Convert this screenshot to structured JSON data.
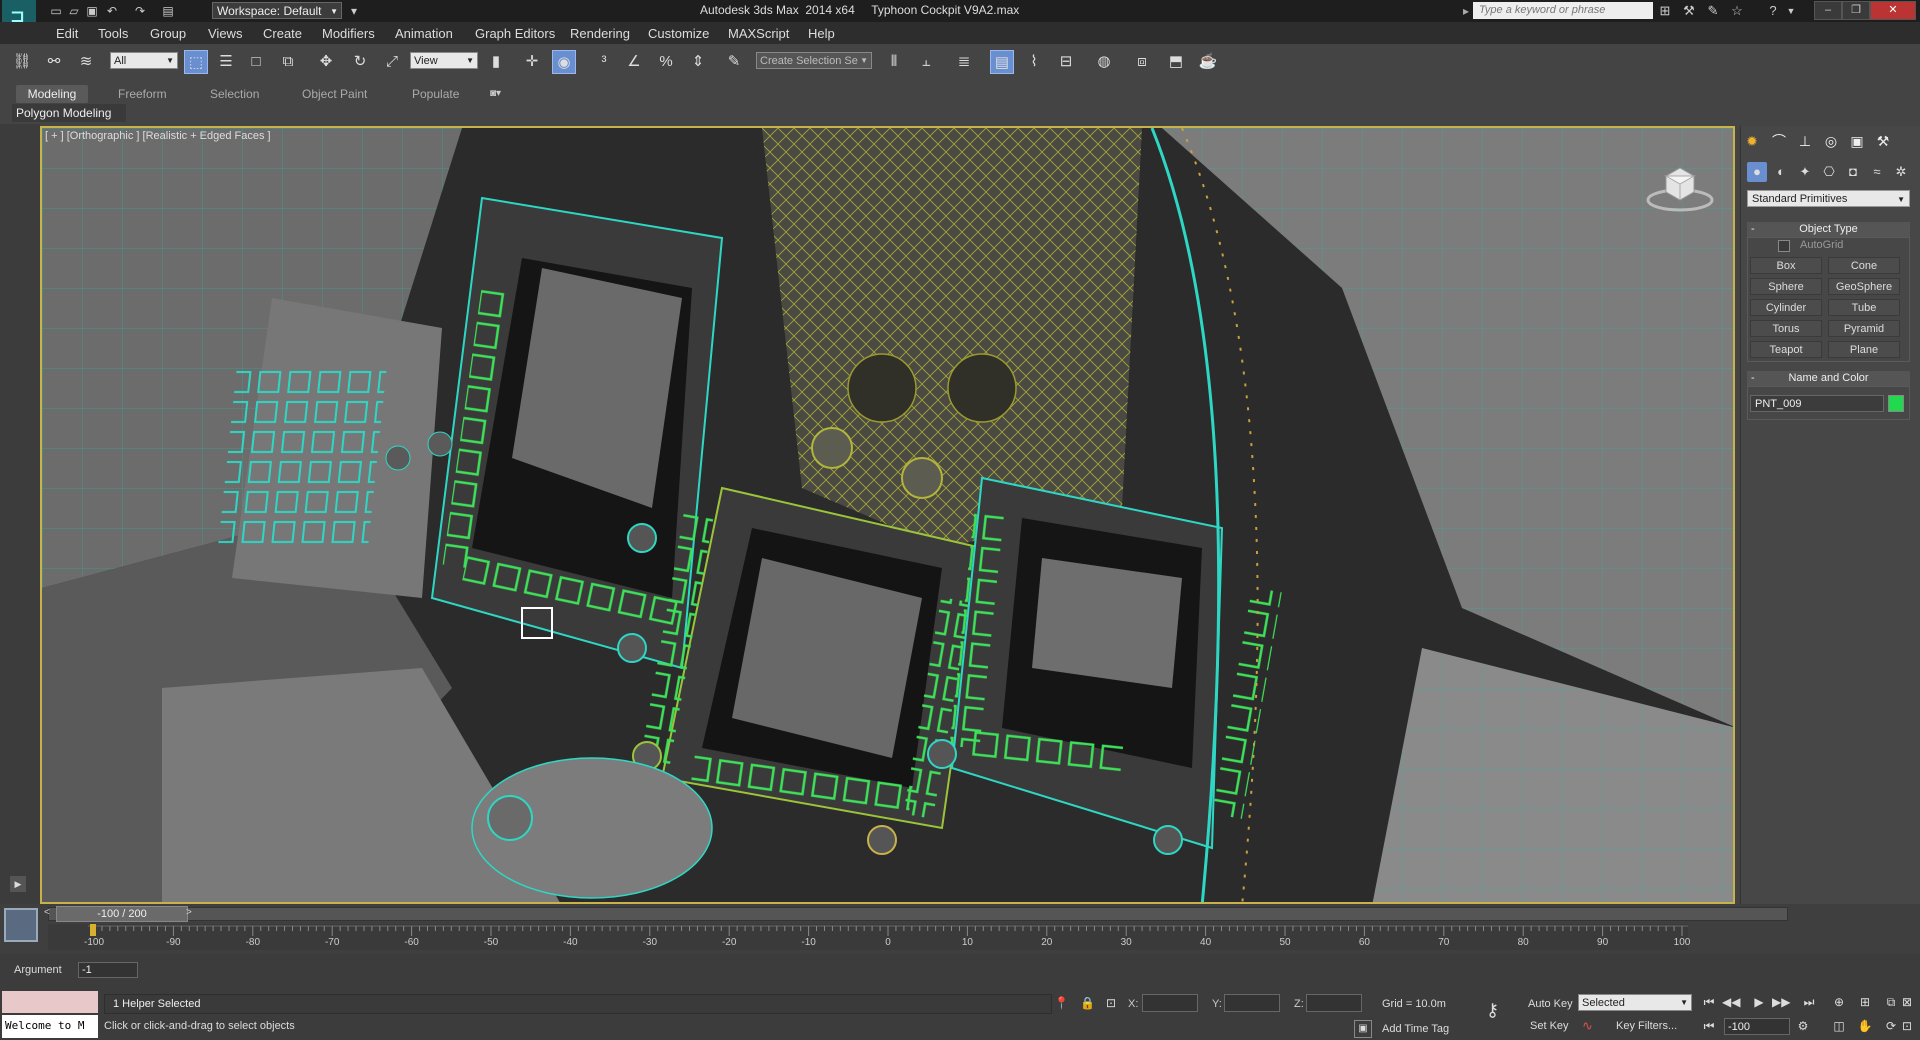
{
  "window": {
    "title": "Autodesk 3ds Max  2014 x64     Typhoon Cockpit V9A2.max",
    "workspace": "Workspace: Default",
    "search_placeholder": "Type a keyword or phrase"
  },
  "menu": [
    "Edit",
    "Tools",
    "Group",
    "Views",
    "Create",
    "Modifiers",
    "Animation",
    "Graph Editors",
    "Rendering",
    "Customize",
    "MAXScript",
    "Help"
  ],
  "toolbar": {
    "selection_filter": "All",
    "reference_coord": "View",
    "named_selection_placeholder": "Create Selection Se"
  },
  "ribbon": {
    "tabs": [
      "Modeling",
      "Freeform",
      "Selection",
      "Object Paint",
      "Populate"
    ],
    "active_tab": "Modeling",
    "panel": "Polygon Modeling"
  },
  "viewport": {
    "label": "[ + ] [Orthographic ] [Realistic + Edged Faces ]"
  },
  "command_panel": {
    "category": "Standard Primitives",
    "object_type_title": "Object Type",
    "autogrid": "AutoGrid",
    "primitives": [
      "Box",
      "Cone",
      "Sphere",
      "GeoSphere",
      "Cylinder",
      "Tube",
      "Torus",
      "Pyramid",
      "Teapot",
      "Plane"
    ],
    "name_color_title": "Name and Color",
    "object_name": "PNT_009",
    "object_color": "#21d94e"
  },
  "timeline": {
    "frame_display": "-100 / 200",
    "ticks": [
      "-100",
      "-90",
      "-80",
      "-70",
      "-60",
      "-50",
      "-40",
      "-30",
      "-20",
      "-10",
      "0",
      "10",
      "20",
      "30",
      "40",
      "50",
      "60",
      "70",
      "80",
      "90",
      "100"
    ]
  },
  "status": {
    "argument_label": "Argument",
    "argument_value": "-1",
    "listener_text": "Welcome to M",
    "selection": "1 Helper Selected",
    "prompt": "Click or click-and-drag to select objects",
    "x_label": "X:",
    "y_label": "Y:",
    "z_label": "Z:",
    "grid": "Grid = 10.0m",
    "add_time_tag": "Add Time Tag",
    "auto_key": "Auto Key",
    "set_key": "Set Key",
    "key_mode": "Selected",
    "key_filters": "Key Filters...",
    "current_frame": "-100"
  }
}
